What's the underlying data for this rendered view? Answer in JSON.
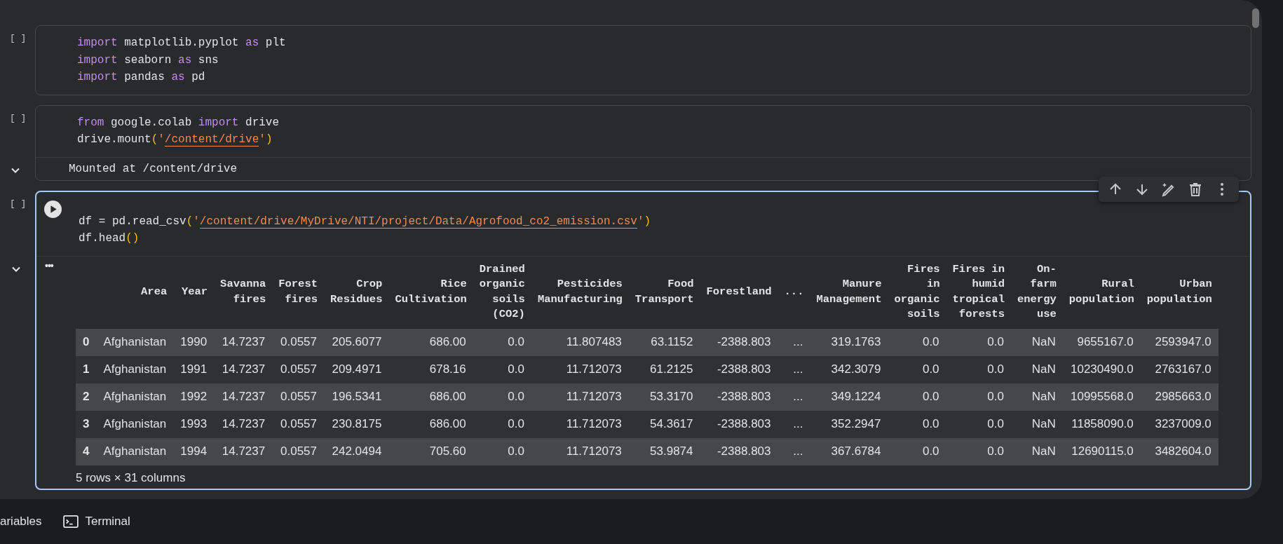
{
  "cells": [
    {
      "label": "[ ]",
      "selected": false,
      "lines": [
        [
          {
            "t": "import",
            "kind": "keyword"
          },
          {
            "t": " matplotlib.pyplot ",
            "kind": "plain"
          },
          {
            "t": "as",
            "kind": "keyword"
          },
          {
            "t": " plt",
            "kind": "plain"
          }
        ],
        [
          {
            "t": "import",
            "kind": "keyword"
          },
          {
            "t": " seaborn ",
            "kind": "plain"
          },
          {
            "t": "as",
            "kind": "keyword"
          },
          {
            "t": " sns",
            "kind": "plain"
          }
        ],
        [
          {
            "t": "import",
            "kind": "keyword"
          },
          {
            "t": " pandas ",
            "kind": "plain"
          },
          {
            "t": "as",
            "kind": "keyword"
          },
          {
            "t": " pd",
            "kind": "plain"
          }
        ]
      ]
    },
    {
      "label": "[ ]",
      "selected": false,
      "lines": [
        [
          {
            "t": "from",
            "kind": "keyword"
          },
          {
            "t": " google.colab ",
            "kind": "plain"
          },
          {
            "t": "import",
            "kind": "keyword"
          },
          {
            "t": " drive",
            "kind": "plain"
          }
        ],
        [
          {
            "t": "drive.mount",
            "kind": "plain"
          },
          {
            "t": "(",
            "kind": "paren"
          },
          {
            "t": "'",
            "kind": "quote"
          },
          {
            "t": "/content/drive",
            "kind": "path"
          },
          {
            "t": "'",
            "kind": "quote"
          },
          {
            "t": ")",
            "kind": "paren"
          }
        ]
      ],
      "output": {
        "expanded": true,
        "kind": "text",
        "text": "Mounted at /content/drive"
      }
    },
    {
      "label": "[ ]",
      "selected": true,
      "lines": [
        [
          {
            "t": "df = pd.read_csv",
            "kind": "plain"
          },
          {
            "t": "(",
            "kind": "paren"
          },
          {
            "t": "'",
            "kind": "quote"
          },
          {
            "t": "/content/drive/MyDrive/NTI/project/Data/Agrofood_co2_emission.csv",
            "kind": "path"
          },
          {
            "t": "'",
            "kind": "quote"
          },
          {
            "t": ")",
            "kind": "paren"
          }
        ],
        [
          {
            "t": "df.head",
            "kind": "plain"
          },
          {
            "t": "()",
            "kind": "paren"
          }
        ]
      ],
      "output": {
        "expanded": true,
        "kind": "table",
        "menu": "•••",
        "columns": [
          "",
          "Area",
          "Year",
          "Savanna fires",
          "Forest fires",
          "Crop Residues",
          "Rice Cultivation",
          "Drained organic soils (CO2)",
          "Pesticides Manufacturing",
          "Food Transport",
          "Forestland",
          "...",
          "Manure Management",
          "Fires in organic soils",
          "Fires in humid tropical forests",
          "On-farm energy use",
          "Rural population",
          "Urban population"
        ],
        "rows": [
          [
            "0",
            "Afghanistan",
            "1990",
            "14.7237",
            "0.0557",
            "205.6077",
            "686.00",
            "0.0",
            "11.807483",
            "63.1152",
            "-2388.803",
            "...",
            "319.1763",
            "0.0",
            "0.0",
            "NaN",
            "9655167.0",
            "2593947.0"
          ],
          [
            "1",
            "Afghanistan",
            "1991",
            "14.7237",
            "0.0557",
            "209.4971",
            "678.16",
            "0.0",
            "11.712073",
            "61.2125",
            "-2388.803",
            "...",
            "342.3079",
            "0.0",
            "0.0",
            "NaN",
            "10230490.0",
            "2763167.0"
          ],
          [
            "2",
            "Afghanistan",
            "1992",
            "14.7237",
            "0.0557",
            "196.5341",
            "686.00",
            "0.0",
            "11.712073",
            "53.3170",
            "-2388.803",
            "...",
            "349.1224",
            "0.0",
            "0.0",
            "NaN",
            "10995568.0",
            "2985663.0"
          ],
          [
            "3",
            "Afghanistan",
            "1993",
            "14.7237",
            "0.0557",
            "230.8175",
            "686.00",
            "0.0",
            "11.712073",
            "54.3617",
            "-2388.803",
            "...",
            "352.2947",
            "0.0",
            "0.0",
            "NaN",
            "11858090.0",
            "3237009.0"
          ],
          [
            "4",
            "Afghanistan",
            "1994",
            "14.7237",
            "0.0557",
            "242.0494",
            "705.60",
            "0.0",
            "11.712073",
            "53.9874",
            "-2388.803",
            "...",
            "367.6784",
            "0.0",
            "0.0",
            "NaN",
            "12690115.0",
            "3482604.0"
          ]
        ],
        "shape": "5 rows × 31 columns"
      }
    }
  ],
  "bottom_bar": [
    {
      "label": "ariables",
      "kind": "plain"
    },
    {
      "label": "Terminal",
      "kind": "terminal"
    }
  ]
}
